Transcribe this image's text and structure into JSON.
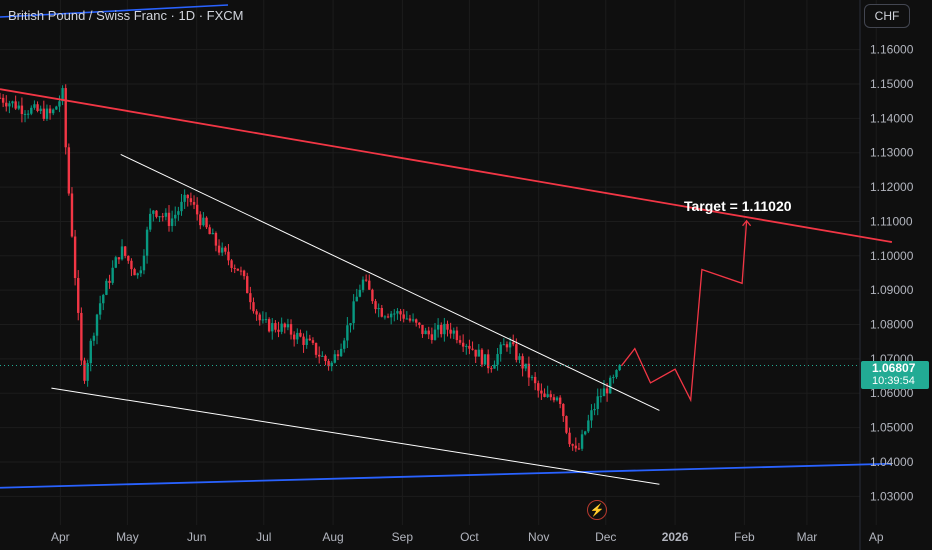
{
  "header": {
    "title": "British Pound / Swiss Franc · 1D · FXCM"
  },
  "currency_button": "CHF",
  "last_price": {
    "value": "1.06807",
    "countdown": "10:39:54"
  },
  "annotation": {
    "target_text": "Target = 1.11020"
  },
  "icons": {
    "event": "lightning-bolt-icon"
  },
  "colors": {
    "background": "#0f0f0f",
    "up_candle": "#089981",
    "down_candle": "#f23645",
    "resistance_line": "#f23645",
    "support_line": "#2962ff",
    "wedge_lines": "#ffffff",
    "projection": "#f23645",
    "price_badge": "#22ab94"
  },
  "chart_data": {
    "type": "candlestick",
    "title": "British Pound / Swiss Franc · 1D · FXCM",
    "y_axis": {
      "ticks": [
        "1.16000",
        "1.15000",
        "1.14000",
        "1.13000",
        "1.12000",
        "1.11000",
        "1.10000",
        "1.09000",
        "1.08000",
        "1.07000",
        "1.06000",
        "1.05000",
        "1.04000",
        "1.03000"
      ],
      "ylim": [
        1.027,
        1.17
      ]
    },
    "x_axis": {
      "ticks": [
        "Apr",
        "May",
        "Jun",
        "Jul",
        "Aug",
        "Sep",
        "Oct",
        "Nov",
        "Dec",
        "2026",
        "Feb",
        "Mar",
        "Ap"
      ]
    },
    "price_path": [
      [
        "2025-03-05",
        1.146
      ],
      [
        "2025-03-15",
        1.143
      ],
      [
        "2025-03-28",
        1.141
      ],
      [
        "2025-04-02",
        1.147
      ],
      [
        "2025-04-04",
        1.125
      ],
      [
        "2025-04-07",
        1.1
      ],
      [
        "2025-04-11",
        1.063
      ],
      [
        "2025-04-18",
        1.085
      ],
      [
        "2025-04-28",
        1.102
      ],
      [
        "2025-05-06",
        1.094
      ],
      [
        "2025-05-12",
        1.114
      ],
      [
        "2025-05-20",
        1.11
      ],
      [
        "2025-05-28",
        1.117
      ],
      [
        "2025-06-05",
        1.108
      ],
      [
        "2025-06-12",
        1.101
      ],
      [
        "2025-06-20",
        1.096
      ],
      [
        "2025-06-30",
        1.08
      ],
      [
        "2025-07-10",
        1.079
      ],
      [
        "2025-07-20",
        1.075
      ],
      [
        "2025-07-31",
        1.068
      ],
      [
        "2025-08-08",
        1.08
      ],
      [
        "2025-08-14",
        1.093
      ],
      [
        "2025-08-22",
        1.084
      ],
      [
        "2025-09-01",
        1.083
      ],
      [
        "2025-09-12",
        1.077
      ],
      [
        "2025-09-22",
        1.079
      ],
      [
        "2025-10-01",
        1.074
      ],
      [
        "2025-10-10",
        1.068
      ],
      [
        "2025-10-18",
        1.075
      ],
      [
        "2025-10-27",
        1.066
      ],
      [
        "2025-11-03",
        1.058
      ],
      [
        "2025-11-10",
        1.06
      ],
      [
        "2025-11-14",
        1.048
      ],
      [
        "2025-11-18",
        1.042
      ],
      [
        "2025-11-24",
        1.053
      ],
      [
        "2025-11-28",
        1.059
      ],
      [
        "2025-12-05",
        1.064
      ],
      [
        "2025-12-08",
        1.068
      ]
    ],
    "lines": [
      {
        "name": "resistance",
        "from": [
          "2025-03-05",
          1.1485
        ],
        "to": [
          "2026-04-08",
          1.104
        ]
      },
      {
        "name": "support",
        "from": [
          "2025-03-05",
          1.0325
        ],
        "to": [
          "2026-04-08",
          1.0395
        ]
      },
      {
        "name": "wedge-upper",
        "from": [
          "2025-04-28",
          1.1295
        ],
        "to": [
          "2025-12-25",
          1.055
        ]
      },
      {
        "name": "wedge-lower",
        "from": [
          "2025-03-28",
          1.0615
        ],
        "to": [
          "2025-12-25",
          1.0335
        ]
      }
    ],
    "projection": [
      [
        "2025-12-08",
        1.068
      ],
      [
        "2025-12-14",
        1.073
      ],
      [
        "2025-12-21",
        1.063
      ],
      [
        "2026-01-01",
        1.067
      ],
      [
        "2026-01-08",
        1.058
      ],
      [
        "2026-01-13",
        1.096
      ],
      [
        "2026-01-31",
        1.092
      ],
      [
        "2026-02-02",
        1.1102
      ]
    ],
    "last_price": 1.06807,
    "target": 1.1102
  }
}
